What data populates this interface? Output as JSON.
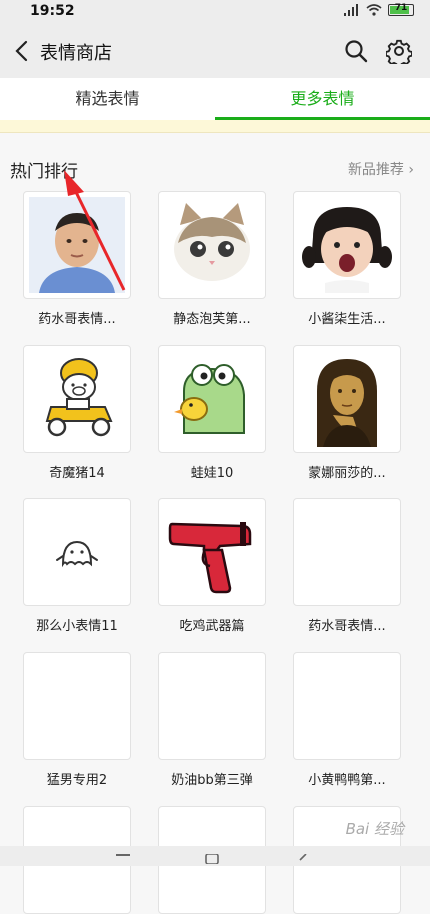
{
  "status": {
    "time": "19:52",
    "battery": "71"
  },
  "nav": {
    "title": "表情商店"
  },
  "tabs": [
    {
      "label": "精选表情"
    },
    {
      "label": "更多表情"
    }
  ],
  "section": {
    "title": "热门排行",
    "more": "新品推荐"
  },
  "stickers": [
    {
      "label": "药水哥表情...",
      "icon": "man-face-icon"
    },
    {
      "label": "静态泡芙第...",
      "icon": "cat-face-icon"
    },
    {
      "label": "小酱柒生活...",
      "icon": "girl-face-icon"
    },
    {
      "label": "奇魔猪14",
      "icon": "pig-scooter-icon"
    },
    {
      "label": "蛙娃10",
      "icon": "frog-duck-icon"
    },
    {
      "label": "蒙娜丽莎的...",
      "icon": "mona-lisa-icon"
    },
    {
      "label": "那么小表情11",
      "icon": "small-ghost-icon"
    },
    {
      "label": "吃鸡武器篇",
      "icon": "flare-gun-icon"
    },
    {
      "label": "药水哥表情...",
      "icon": "blank"
    },
    {
      "label": "猛男专用2",
      "icon": "blank"
    },
    {
      "label": "奶油bb第三弹",
      "icon": "blank"
    },
    {
      "label": "小黄鸭鸭第...",
      "icon": "blank"
    },
    {
      "label": "",
      "icon": "blank"
    },
    {
      "label": "",
      "icon": "blank"
    },
    {
      "label": "",
      "icon": "blank"
    }
  ],
  "watermark": "Bai 经验"
}
